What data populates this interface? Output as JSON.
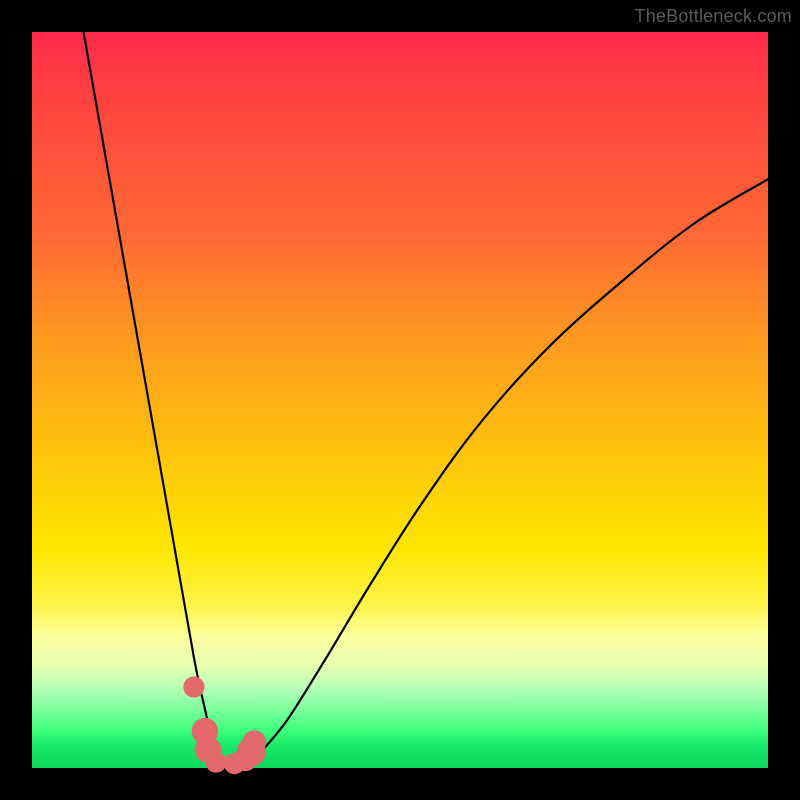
{
  "watermark": "TheBottleneck.com",
  "chart_data": {
    "type": "line",
    "title": "",
    "xlabel": "",
    "ylabel": "",
    "xlim": [
      0,
      100
    ],
    "ylim": [
      0,
      100
    ],
    "series": [
      {
        "name": "bottleneck-curve",
        "x": [
          7,
          10,
          13,
          16,
          19,
          22,
          23.5,
          24.5,
          25.5,
          27,
          28.5,
          30,
          32,
          35,
          40,
          46,
          53,
          61,
          70,
          80,
          90,
          100
        ],
        "values": [
          100,
          83,
          66,
          49,
          32,
          15,
          8,
          4,
          1.5,
          0.5,
          0.5,
          1.2,
          3.2,
          7,
          15,
          25,
          36,
          47,
          57,
          66,
          74,
          80
        ]
      }
    ],
    "markers": {
      "name": "highlight-points",
      "color": "#e26a6a",
      "points": [
        {
          "x": 22.0,
          "y": 11.0,
          "r": 1.0
        },
        {
          "x": 23.5,
          "y": 5.0,
          "r": 1.4
        },
        {
          "x": 23.9,
          "y": 2.5,
          "r": 1.4
        },
        {
          "x": 25.0,
          "y": 0.8,
          "r": 1.0
        },
        {
          "x": 27.5,
          "y": 0.6,
          "r": 1.0
        },
        {
          "x": 29.0,
          "y": 1.2,
          "r": 1.2
        },
        {
          "x": 29.8,
          "y": 2.2,
          "r": 1.6
        },
        {
          "x": 30.2,
          "y": 3.5,
          "r": 1.2
        }
      ]
    },
    "gradient_stops": [
      {
        "pos": 0,
        "color": "#ff2a4d"
      },
      {
        "pos": 28,
        "color": "#ff6a34"
      },
      {
        "pos": 58,
        "color": "#ffc60a"
      },
      {
        "pos": 82,
        "color": "#fdff9d"
      },
      {
        "pos": 95,
        "color": "#3cff7a"
      },
      {
        "pos": 100,
        "color": "#0cd85e"
      }
    ]
  }
}
